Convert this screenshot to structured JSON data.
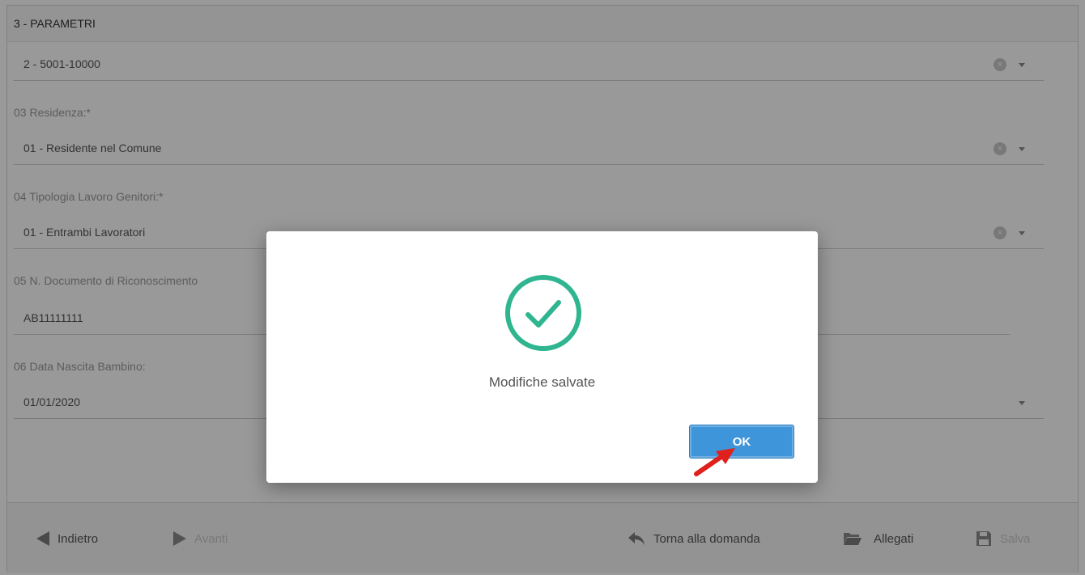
{
  "section": {
    "title": "3 - PARAMETRI"
  },
  "fields": {
    "reddito": {
      "value": "2 - 5001-10000"
    },
    "residenza": {
      "label": "03 Residenza:*",
      "value": "01 - Residente nel Comune"
    },
    "tipologia_lavoro": {
      "label": "04 Tipologia Lavoro Genitori:*",
      "value": "01 - Entrambi Lavoratori"
    },
    "documento": {
      "label": "05 N. Documento di Riconoscimento",
      "value": "AB11111111"
    },
    "data_nascita": {
      "label": "06 Data Nascita Bambino:",
      "value": "01/01/2020"
    }
  },
  "footer": {
    "back_label": "Indietro",
    "next_label": "Avanti",
    "return_label": "Torna alla domanda",
    "attachments_label": "Allegati",
    "save_label": "Salva"
  },
  "modal": {
    "message": "Modifiche salvate",
    "ok_label": "OK",
    "success_color": "#2fb58f"
  },
  "colors": {
    "primary_button": "#3f95d9",
    "annotation_arrow": "#e0201c"
  }
}
